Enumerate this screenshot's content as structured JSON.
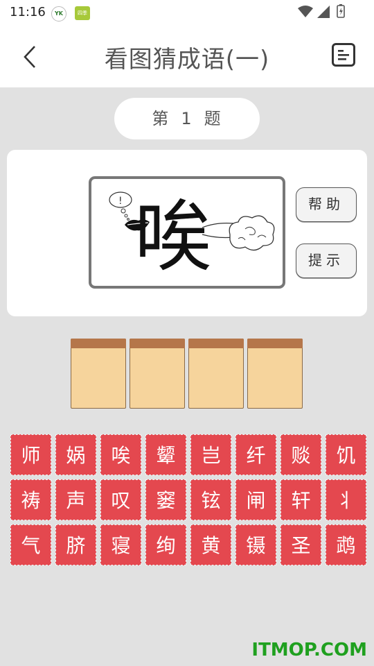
{
  "status": {
    "time": "11:16",
    "app1": "YK",
    "app2": "四季"
  },
  "header": {
    "title": "看图猜成语(一)"
  },
  "question": {
    "prefix": "第",
    "number": "1",
    "suffix": "题"
  },
  "puzzle": {
    "glyph": "唉"
  },
  "buttons": {
    "help": "帮助",
    "hint": "提示"
  },
  "answer_slots": [
    "",
    "",
    "",
    ""
  ],
  "keys": [
    "师",
    "娲",
    "唉",
    "颦",
    "岂",
    "纤",
    "赕",
    "饥",
    "祷",
    "声",
    "叹",
    "窭",
    "铉",
    "闸",
    "轩",
    "丬",
    "气",
    "脐",
    "寝",
    "绚",
    "黄",
    "镊",
    "圣",
    "鹉"
  ],
  "watermark": "ITMOP.COM"
}
